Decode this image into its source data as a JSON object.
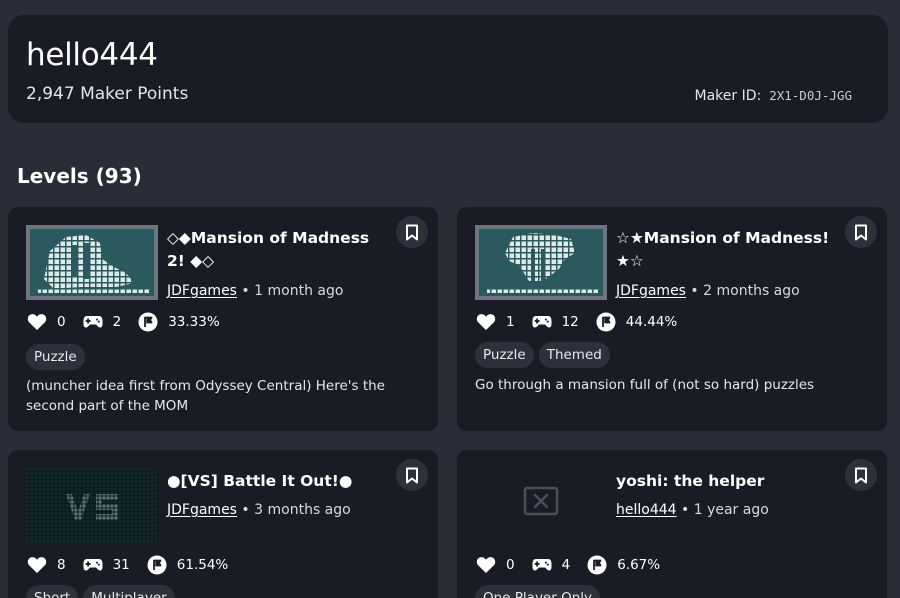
{
  "profile": {
    "name": "hello444",
    "points": "2,947 Maker Points",
    "maker_id_label": "Maker ID:",
    "maker_id": "2X1-D0J-JGG"
  },
  "levels_heading": "Levels (93)",
  "levels": [
    {
      "title": "◇◆Mansion of Madness 2! ◆◇",
      "maker": "JDFgames",
      "age": " • 1 month ago",
      "likes": "0",
      "plays": "2",
      "clear_rate": "33.33%",
      "tags": [
        "Puzzle"
      ],
      "description": "(muncher idea first from Odyssey Central) Here's the second part of the MOM",
      "thumbnail": "mansion-thumbnail"
    },
    {
      "title": "☆★Mansion of Madness! ★☆",
      "maker": "JDFgames",
      "age": " • 2 months ago",
      "likes": "1",
      "plays": "12",
      "clear_rate": "44.44%",
      "tags": [
        "Puzzle",
        "Themed"
      ],
      "description": "Go through a mansion full of (not so hard) puzzles",
      "thumbnail": "mansion-thumbnail"
    },
    {
      "title": "●[VS] Battle It Out!●",
      "maker": "JDFgames",
      "age": " • 3 months ago",
      "likes": "8",
      "plays": "31",
      "clear_rate": "61.54%",
      "tags": [
        "Short",
        "Multiplayer"
      ],
      "description": "",
      "thumbnail": "vs-thumbnail"
    },
    {
      "title": "yoshi: the helper",
      "maker": "hello444",
      "age": " • 1 year ago",
      "likes": "0",
      "plays": "4",
      "clear_rate": "6.67%",
      "tags": [
        "One Player Only"
      ],
      "description": "",
      "thumbnail": "missing-image-icon"
    }
  ],
  "colors": {
    "background": "#2a2d38",
    "card": "#1a1c25",
    "chip": "#2e313c"
  }
}
